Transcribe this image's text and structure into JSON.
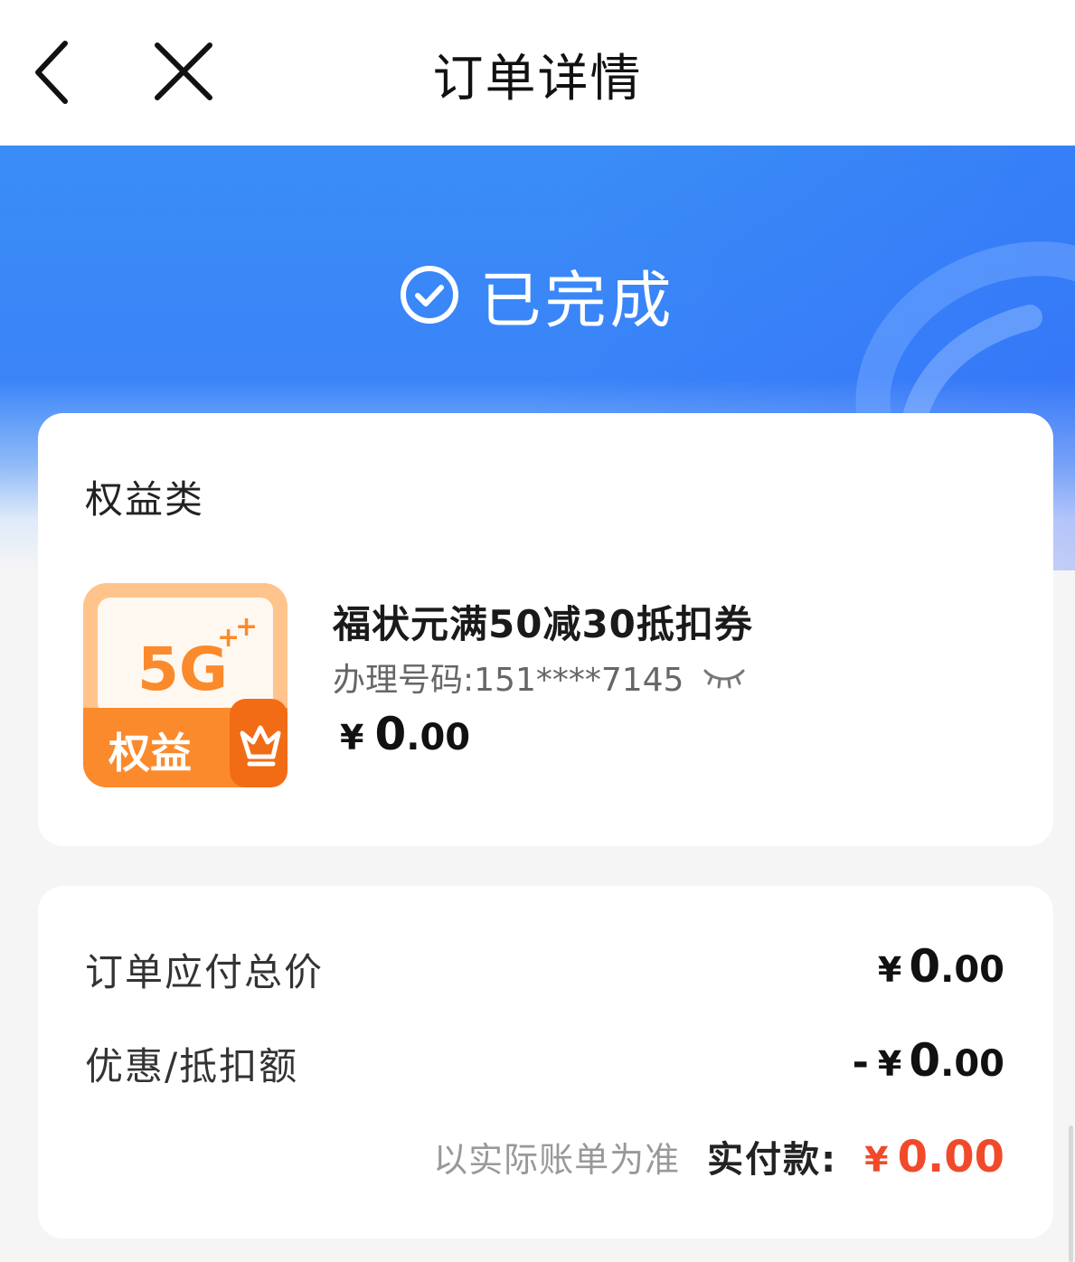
{
  "header": {
    "title": "订单详情",
    "back_icon": "chevron-left-icon",
    "close_icon": "close-icon"
  },
  "status": {
    "text": "已完成",
    "icon": "check-circle-icon",
    "banner_color": "#3a8df6"
  },
  "product_card": {
    "category": "权益类",
    "thumbnail": {
      "logo_text": "5G",
      "badge_text": "权益",
      "icon": "crown-icon",
      "color": "#fb8a2c"
    },
    "name": "福状元满50减30抵扣券",
    "phone_label": "办理号码:151****7145",
    "eye_icon": "eye-closed-icon",
    "price": {
      "currency": "¥",
      "integer": "0",
      "decimal": ".00"
    }
  },
  "summary": {
    "total_label": "订单应付总价",
    "total_value": {
      "currency": "¥",
      "integer": "0",
      "decimal": ".00"
    },
    "discount_label": "优惠/抵扣额",
    "discount_value": {
      "sign": "-",
      "currency": "¥",
      "integer": "0",
      "decimal": ".00"
    },
    "note": "以实际账单为准",
    "paid_label": "实付款:",
    "paid_value": {
      "currency": "¥",
      "amount": "0.00"
    },
    "paid_color": "#f04a2b"
  }
}
